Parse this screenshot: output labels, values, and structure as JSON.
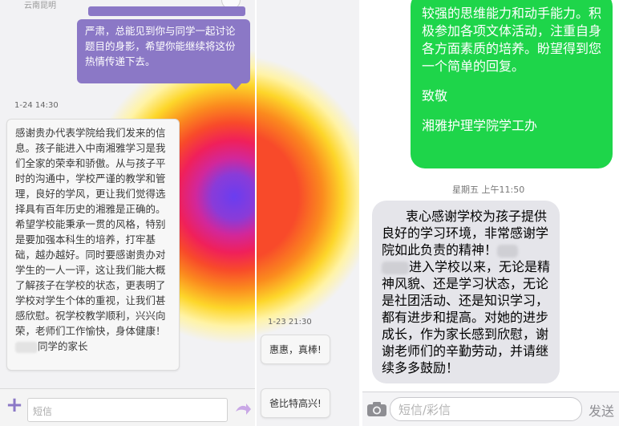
{
  "left": {
    "top_label": "云南昆明",
    "purple_message": "严肃，总能见到你与同学一起讨论题目的身影，希望你能继续将这份热情传递下去。",
    "timestamp": "1-24 14:30",
    "white_message": "感谢贵办代表学院给我们发来的信息。孩子能进入中南湘雅学习是我们全家的荣幸和骄傲。从与孩子平时的沟通中，学校严谨的教学和管理，良好的学风，更让我们觉得选择具有百年历史的湘雅是正确的。希望学校能秉承一贯的风格，特别是要加强本科生的培养，打牢基础，越办越好。同时要感谢贵办对学生的一人一评，这让我们能大概了解孩子在学校的状态，更表明了学校对学生个体的重视，让我们甚感欣慰。祝学校教学顺利，兴兴向荣，老师们工作愉快，身体健康！",
    "signature": "同学的家长",
    "input_placeholder": "短信",
    "accent_color": "#8b78c6"
  },
  "middle": {
    "timestamp": "1-23 21:30",
    "bubble_1": "惠惠，真棒!",
    "bubble_2": "爸比特高兴!"
  },
  "right": {
    "green_message_body": "较强的思维能力和动手能力。积极参加各项文体活动，注重自身各方面素质的培养。盼望得到您一个简单的回复。",
    "green_closing": "致敬",
    "green_sender": "湘雅护理学院学工办",
    "timestamp": "星期五 上午11:50",
    "gray_message_part1": "衷心感谢学校为孩子提供良好的学习环境，非常感谢学院如此负责的精神！",
    "gray_message_part2": "进入学校以来，无论是精神风貌、还是学习状态，无论是社团活动、还是知识学习，都有进步和提高。对她的进步成长，作为家长感到欣慰，谢谢老师们的辛勤劳动，并请继续多多鼓励！",
    "input_placeholder": "短信/彩信",
    "send_label": "发送",
    "sent_color": "#1ed54a",
    "received_color": "#e5e5ea"
  },
  "icons": [
    "plus-icon",
    "send-arrow-icon",
    "camera-icon"
  ]
}
